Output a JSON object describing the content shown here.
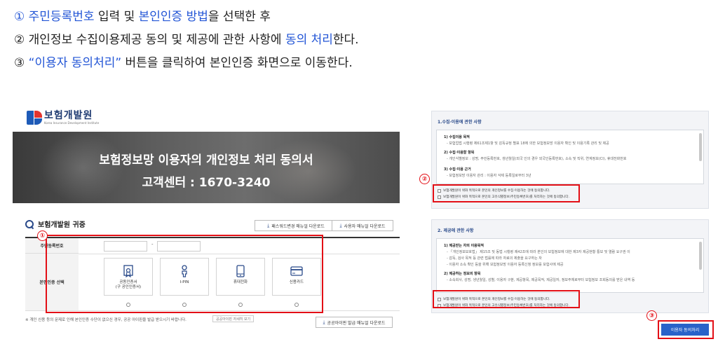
{
  "instructions": [
    {
      "num": "①",
      "parts": [
        {
          "text": "주민등록번호",
          "hl": true
        },
        {
          "text": " 입력 및 ",
          "hl": false
        },
        {
          "text": "본인인증 방법",
          "hl": true
        },
        {
          "text": "을 선택한 후",
          "hl": false
        }
      ]
    },
    {
      "num": "②",
      "parts": [
        {
          "text": "개인정보 수집이용제공 동의 및 제공에 관한 사항에 ",
          "hl": false
        },
        {
          "text": "동의 처리",
          "hl": true
        },
        {
          "text": "한다.",
          "hl": false
        }
      ]
    },
    {
      "num": "③",
      "parts": [
        {
          "text": "“이용자 동의처리”",
          "hl": true
        },
        {
          "text": " 버튼을 클릭하여 본인인증 화면으로 이동한다.",
          "hl": false
        }
      ]
    }
  ],
  "left": {
    "logo_text": "보험개발원",
    "logo_sub": "Korea Insurance Development Institute",
    "banner_title": "보험정보망 이용자의 개인정보 처리 동의서",
    "banner_sub": "고객센터 : 1670-3240",
    "section_title": "보험개발원 귀중",
    "download_1": "패스워드변경 매뉴얼 다운로드",
    "download_2": "사용자 매뉴얼 다운로드",
    "download_3": "공공아이핀 발급 매뉴얼 다운로드",
    "label_id": "주민등록번호",
    "label_auth": "본인인증 선택",
    "id_dash": "-",
    "auth_options": [
      {
        "label": "공동인증서\n(구 공인인증서)",
        "icon": "certificate-icon"
      },
      {
        "label": "I-PIN",
        "icon": "person-icon"
      },
      {
        "label": "휴대전화",
        "icon": "phone-icon"
      },
      {
        "label": "신용카드",
        "icon": "card-icon"
      }
    ],
    "notice": "※ 개인 신용 등의 문제로 인해 본인인증 수단이 없으신 경우, 공공 아이핀을 발급 받으시기 바랍니다.",
    "notice_link": "공공아이핀 자세히 보기",
    "badge": "①"
  },
  "right": {
    "panel1_title": "1.수집·이용에 관한 사항",
    "panel1_items": [
      {
        "t": "1) 수집이용 목적",
        "k": "b"
      },
      {
        "t": "- 보험업법 시행령 제61조제1항 및 감독규정 별표 18에 의한 보험정보망 이용자 확인 및 이용기록 관리 및 제공",
        "k": "s"
      },
      {
        "t": "2) 수집·이용할 항목",
        "k": "b"
      },
      {
        "t": "- 개인식별정보 : 성명, 주민등록번호, 생년월일(외국 인의 경우 외국인등록번호), 소속 및 직위, 연계정보(CI), 휴대전화번호",
        "k": "s"
      },
      {
        "t": "3) 수집·이용 근거",
        "k": "b"
      },
      {
        "t": "- 보험정보망 이용자 관리 : 이용자 삭제 등록일로부터 3년",
        "k": "s"
      }
    ],
    "panel1_checks": [
      "보험개발원이 위와 목적으로 본인의 개인정보를 수집·이용하는 것에 동의합니다.",
      "보험개발원이 위와 목적으로 본인의 고유식별정보(주민등록번호)를 처리하는 것에 동의합니다."
    ],
    "panel2_title": "2. 제공에 관한 사항",
    "panel2_items": [
      {
        "t": "1) 제공받는 자의 이용목적",
        "k": "b"
      },
      {
        "t": "- 「개인정보보호법」 제15조 및 동법 시행령 제42조에 따라 본인의 보험정보에 대한 제3자 제공현황 통보 및 열람 요구권 이",
        "k": "s"
      },
      {
        "t": "- 감독, 검사 목적 등 관련 법률에 따라 자료의 제출을 요구하는 자",
        "k": "s"
      },
      {
        "t": "- 이용자 소속 확인 등을 위해 보험정보망 이용자 등록신청 정보를 보험사에 제공",
        "k": "s"
      },
      {
        "t": "2) 제공하는 정보의 항목",
        "k": "b"
      },
      {
        "t": "- 소속회사, 성명, 생년월일, 성별, 이용자 구분, 제공항목, 제공목적, 제공일자, 정보주체로부터 보험정보 조회동의를 받은 내역 등",
        "k": "s"
      }
    ],
    "panel2_checks": [
      "보험개발원이 위와 목적으로 본인의 개인정보를 수집·이용하는 것에 동의합니다.",
      "보험개발원이 위와 목적으로 본인의 고유식별정보(주민등록번호)를 처리하는 것에 동의합니다."
    ],
    "agree_button": "이용자 동의처리",
    "badge_2": "②",
    "badge_3": "③"
  }
}
